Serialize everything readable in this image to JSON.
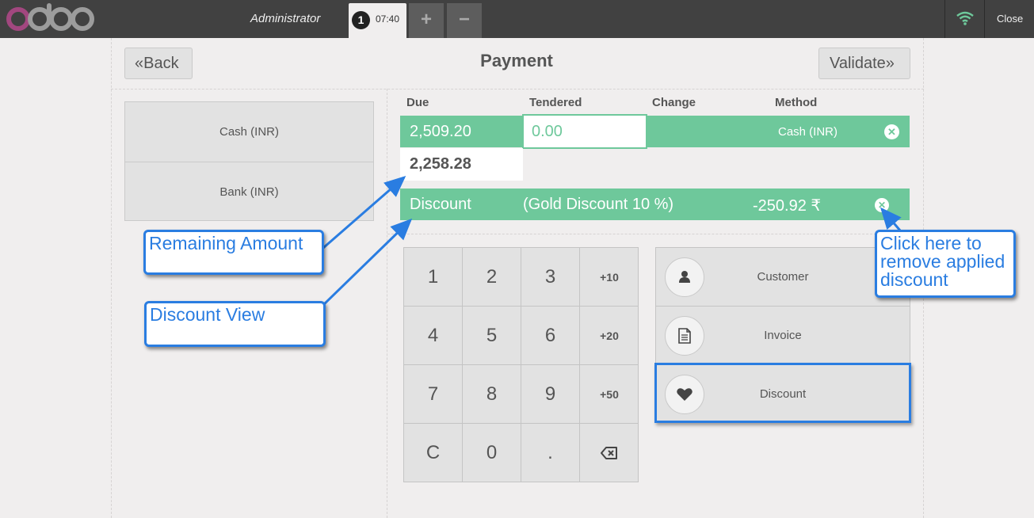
{
  "app": {
    "logo_text": "odoo",
    "user": "Administrator",
    "close_label": "Close"
  },
  "orders": {
    "current_number": "1",
    "current_time": "07:40",
    "add_label": "+",
    "remove_label": "−"
  },
  "header": {
    "back_label": "Back",
    "title": "Payment",
    "validate_label": "Validate"
  },
  "payment_methods": [
    "Cash (INR)",
    "Bank (INR)"
  ],
  "columns": {
    "due": "Due",
    "tendered": "Tendered",
    "change": "Change",
    "method": "Method"
  },
  "payment_line": {
    "due": "2,509.20",
    "tendered": "0.00",
    "method": "Cash (INR)"
  },
  "remaining": "2,258.28",
  "discount_line": {
    "label": "Discount",
    "name": "(Gold Discount 10 %)",
    "amount": "-250.92 ₹"
  },
  "numpad": {
    "keys": [
      "1",
      "2",
      "3",
      "+10",
      "4",
      "5",
      "6",
      "+20",
      "7",
      "8",
      "9",
      "+50",
      "C",
      "0",
      "."
    ],
    "backspace_icon": "backspace-icon"
  },
  "actions": [
    {
      "label": "Customer",
      "icon": "user-icon"
    },
    {
      "label": "Invoice",
      "icon": "document-icon"
    },
    {
      "label": "Discount",
      "icon": "heart-icon"
    }
  ],
  "annotations": {
    "remaining_amount": "Remaining Amount",
    "discount_view": "Discount View",
    "remove_discount": [
      "Click here to",
      "remove applied",
      "discount"
    ]
  },
  "colors": {
    "accent_green": "#6ec89b",
    "callout_blue": "#2a7de1",
    "topbar": "#414141",
    "logo_purple": "#a2477f",
    "wifi_green": "#6ec89b"
  }
}
